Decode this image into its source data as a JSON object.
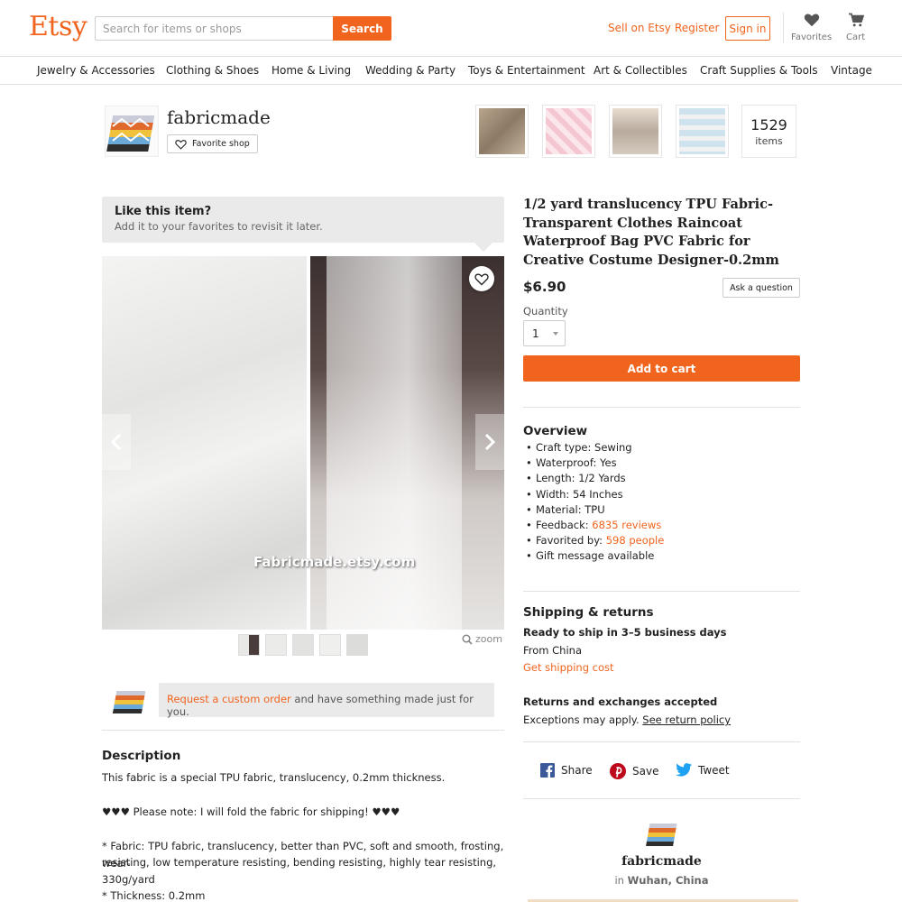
{
  "header": {
    "logo": "Etsy",
    "search_placeholder": "Search for items or shops",
    "search_button": "Search",
    "sell_link": "Sell on Etsy",
    "register_link": "Register",
    "signin_button": "Sign in",
    "favorites_label": "Favorites",
    "cart_label": "Cart"
  },
  "categories": [
    "Jewelry & Accessories",
    "Clothing & Shoes",
    "Home & Living",
    "Wedding & Party",
    "Toys & Entertainment",
    "Art & Collectibles",
    "Craft Supplies & Tools",
    "Vintage"
  ],
  "shop": {
    "name": "fabricmade",
    "favorite_button": "Favorite shop",
    "item_count": "1529",
    "items_label": "items"
  },
  "like_box": {
    "title": "Like this item?",
    "subtitle": "Add it to your favorites to revisit it later."
  },
  "image": {
    "watermark": "Fabricmade.etsy.com",
    "zoom_label": "zoom"
  },
  "custom_order": {
    "link": "Request a custom order",
    "text": " and have something made just for you."
  },
  "description": {
    "title": "Description",
    "lines": [
      "This fabric is a special TPU fabric, translucency, 0.2mm thickness.",
      "♥♥♥ Please note: I will fold the fabric for shipping! ♥♥♥",
      "* Fabric: TPU fabric, translucency, better than PVC, soft and smooth, frosting, wear-",
      "resisting, low temperature resisting, bending resisting, highly tear resisting,",
      "330g/yard",
      "* Thickness: 0.2mm"
    ]
  },
  "listing": {
    "title": "1/2 yard translucency TPU Fabric- Transparent Clothes Raincoat Waterproof Bag PVC Fabric for Creative Costume Designer-0.2mm",
    "price": "$6.90",
    "ask_button": "Ask a question",
    "quantity_label": "Quantity",
    "quantity_value": "1",
    "add_to_cart": "Add to cart"
  },
  "overview": {
    "title": "Overview",
    "craft_type": "Craft type: Sewing",
    "waterproof": "Waterproof: Yes",
    "length": "Length: 1/2 Yards",
    "width": "Width: 54 Inches",
    "material": "Material: TPU",
    "feedback_label": "Feedback: ",
    "feedback_link": "6835 reviews",
    "favorited_label": "Favorited by: ",
    "favorited_link": "598 people",
    "gift": "Gift message available"
  },
  "shipping": {
    "title": "Shipping & returns",
    "ready": "Ready to ship in 3–5 business days",
    "from": "From China",
    "cost_link": "Get shipping cost",
    "returns_title": "Returns and exchanges accepted",
    "exceptions": "Exceptions may apply. ",
    "return_policy_link": "See return policy"
  },
  "social": {
    "share": "Share",
    "save": "Save",
    "tweet": "Tweet"
  },
  "shop_footer": {
    "name": "fabricmade",
    "in_label": "in ",
    "location": "Wuhan, China"
  },
  "colors": {
    "brand": "#f1641e",
    "facebook": "#3b5998",
    "pinterest": "#bd081c",
    "twitter": "#1da1f2"
  },
  "icons": [
    "heart-icon",
    "cart-icon",
    "chevron-left-icon",
    "chevron-right-icon",
    "magnifier-icon",
    "facebook-icon",
    "pinterest-icon",
    "twitter-icon"
  ]
}
